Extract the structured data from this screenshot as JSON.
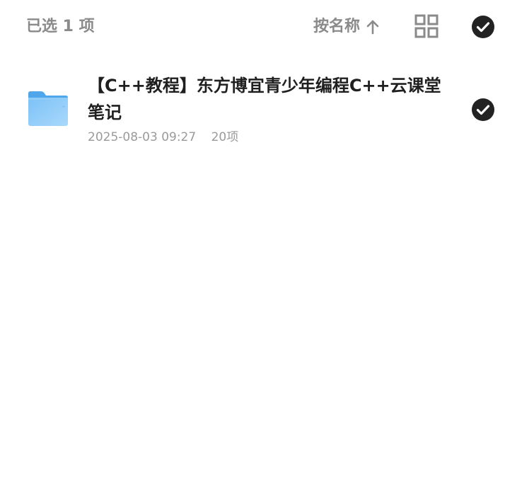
{
  "toolbar": {
    "selected_text": "已选 1 项",
    "sort_label": "按名称",
    "sort_arrow_icon": "arrow-up-icon",
    "view_toggle_icon": "grid-view-icon",
    "select_all_icon": "check-circle-icon"
  },
  "files": [
    {
      "name": "【C++教程】东方博宜青少年编程C++云课堂笔记",
      "date": "2025-08-03 09:27",
      "count": "20项",
      "icon": "folder-icon",
      "selected": true
    }
  ],
  "colors": {
    "muted_text": "#8a8a8a",
    "title_text": "#1f1f1f",
    "check_fill": "#222222",
    "folder_blue": "#6db6f5"
  }
}
